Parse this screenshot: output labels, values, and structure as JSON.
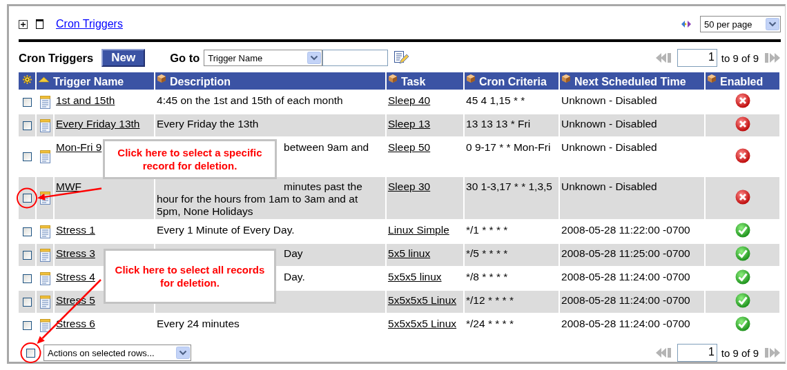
{
  "header": {
    "title_link": "Cron Triggers",
    "per_page": "50 per page"
  },
  "toolbar": {
    "title": "Cron Triggers",
    "new_button": "New",
    "goto_label": "Go to",
    "goto_field": "Trigger Name"
  },
  "pager_top": {
    "page": "1",
    "range": "to 9 of 9"
  },
  "table": {
    "columns": [
      {
        "label": "Trigger Name",
        "sorted": true
      },
      {
        "label": "Description",
        "sorted": false
      },
      {
        "label": "Task",
        "sorted": false
      },
      {
        "label": "Cron Criteria",
        "sorted": false
      },
      {
        "label": "Next Scheduled Time",
        "sorted": false
      },
      {
        "label": "Enabled",
        "sorted": false
      }
    ],
    "rows": [
      {
        "checked": false,
        "name": "1st and 15th",
        "description": "4:45 on the 1st and 15th of each month",
        "task": "Sleep 40",
        "cron": "45 4 1,15 * *",
        "next": "Unknown - Disabled",
        "enabled": false
      },
      {
        "checked": false,
        "name": "Every Friday 13th",
        "description": "Every Friday the 13th",
        "task": "Sleep 13",
        "cron": "13 13 13 * Fri",
        "next": "Unknown - Disabled",
        "enabled": false
      },
      {
        "checked": false,
        "name": "Mon-Fri 9",
        "description": "between 9am and",
        "task": "Sleep 50",
        "cron": "0 9-17 * * Mon-Fri",
        "next": "Unknown - Disabled",
        "enabled": false
      },
      {
        "checked": false,
        "name": "MWF",
        "description": "minutes past the hour for the hours from 1am to 3am and at 5pm, None Holidays",
        "task": "Sleep 30",
        "cron": "30 1-3,17 * * 1,3,5",
        "next": "Unknown - Disabled",
        "enabled": false
      },
      {
        "checked": false,
        "name": "Stress 1",
        "description": "Every 1 Minute of Every Day.",
        "task": "Linux Simple",
        "cron": "*/1 * * * *",
        "next": "2008-05-28 11:22:00 -0700",
        "enabled": true
      },
      {
        "checked": false,
        "name": "Stress 3",
        "description": "Day",
        "task": "5x5 linux",
        "cron": "*/5 * * * *",
        "next": "2008-05-28 11:25:00 -0700",
        "enabled": true
      },
      {
        "checked": false,
        "name": "Stress 4",
        "description": "Day.",
        "task": "5x5x5 linux",
        "cron": "*/8 * * * *",
        "next": "2008-05-28 11:24:00 -0700",
        "enabled": true
      },
      {
        "checked": false,
        "name": "Stress 5",
        "task": "5x5x5x5 Linux",
        "cron": "*/12 * * * *",
        "next": "2008-05-28 11:24:00 -0700",
        "enabled": true
      },
      {
        "checked": false,
        "name": "Stress 6",
        "description": "Every 24 minutes",
        "task": "5x5x5x5 Linux",
        "cron": "*/24 * * * *",
        "next": "2008-05-28 11:24:00 -0700",
        "enabled": true
      }
    ]
  },
  "footer": {
    "select_all_checked": false,
    "actions": "Actions on selected rows..."
  },
  "pager_bottom": {
    "page": "1",
    "range": "to 9 of 9"
  },
  "callouts": [
    {
      "text": "Click here to select a specific record for deletion."
    },
    {
      "text": "Click here to select all records for deletion."
    }
  ]
}
